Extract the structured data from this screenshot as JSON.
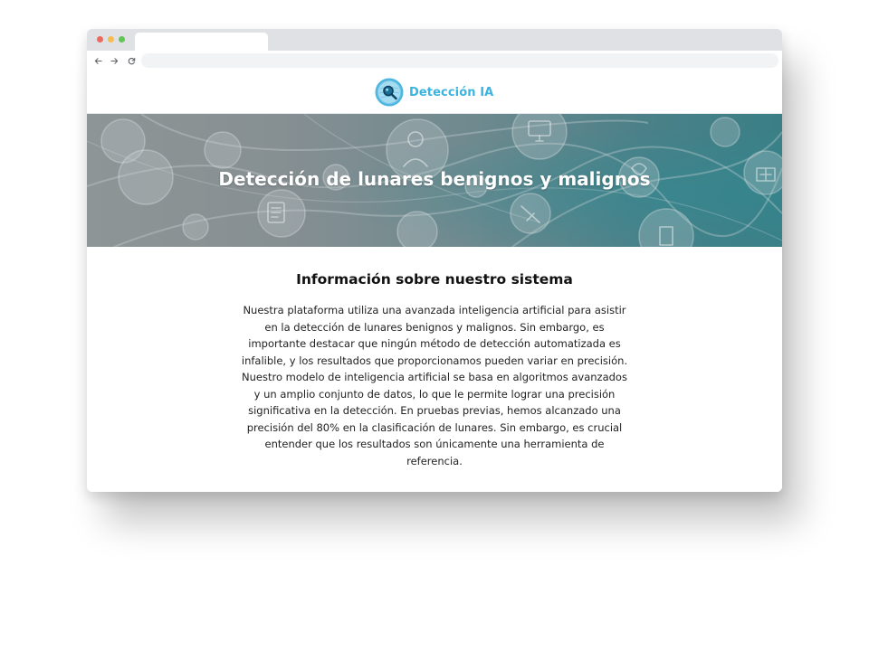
{
  "browser": {
    "tab_title": "",
    "url": "",
    "icons": {
      "back": "arrow-left-icon",
      "forward": "arrow-right-icon",
      "reload": "reload-icon"
    }
  },
  "header": {
    "brand_name": "Detección IA",
    "logo_icon": "magnifier-globe-logo",
    "brand_color": "#3ab4e0"
  },
  "hero": {
    "title": "Detección de lunares benignos y malignos"
  },
  "info": {
    "title": "Información sobre nuestro sistema",
    "paragraph": "Nuestra plataforma utiliza una avanzada inteligencia artificial para asistir en la detección de lunares benignos y malignos. Sin embargo, es importante destacar que ningún método de detección automatizada es infalible, y los resultados que proporcionamos pueden variar en precisión. Nuestro modelo de inteligencia artificial se basa en algoritmos avanzados y un amplio conjunto de datos, lo que le permite lograr una precisión significativa en la detección. En pruebas previas, hemos alcanzado una precisión del 80% en la clasificación de lunares. Sin embargo, es crucial entender que los resultados son únicamente una herramienta de referencia."
  }
}
